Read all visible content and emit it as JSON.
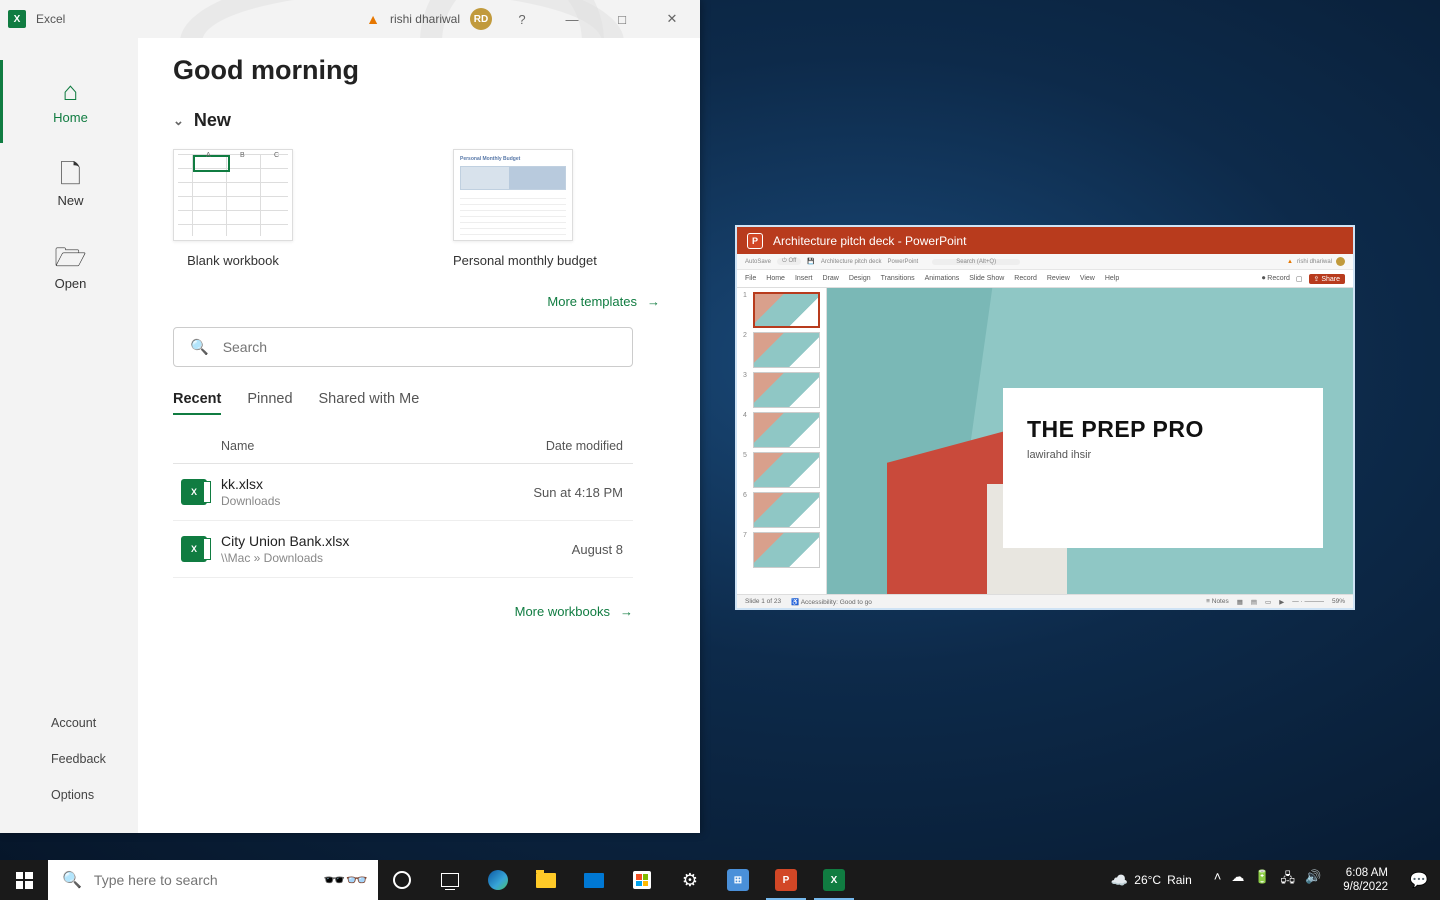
{
  "excel": {
    "app_name": "Excel",
    "user_name": "rishi dhariwal",
    "user_initials": "RD",
    "sidebar": {
      "home": "Home",
      "new": "New",
      "open": "Open",
      "account": "Account",
      "feedback": "Feedback",
      "options": "Options"
    },
    "greeting": "Good morning",
    "new_section": "New",
    "templates": {
      "blank": "Blank workbook",
      "budget": "Personal monthly budget"
    },
    "more_templates": "More templates",
    "search_placeholder": "Search",
    "tabs": {
      "recent": "Recent",
      "pinned": "Pinned",
      "shared": "Shared with Me"
    },
    "columns": {
      "name": "Name",
      "date": "Date modified"
    },
    "files": [
      {
        "name": "kk.xlsx",
        "path": "Downloads",
        "date": "Sun at 4:18 PM"
      },
      {
        "name": "City Union Bank.xlsx",
        "path": "\\\\Mac » Downloads",
        "date": "August 8"
      }
    ],
    "more_workbooks": "More workbooks"
  },
  "ppt": {
    "window_title": "Architecture pitch deck - PowerPoint",
    "autosave": "AutoSave",
    "doc_name": "Architecture pitch deck",
    "app_hint": "PowerPoint",
    "search_hint": "Search (Alt+Q)",
    "user_name": "rishi dhariwal",
    "ribbon": [
      "File",
      "Home",
      "Insert",
      "Draw",
      "Design",
      "Transitions",
      "Animations",
      "Slide Show",
      "Record",
      "Review",
      "View",
      "Help"
    ],
    "record_btn": "Record",
    "share_btn": "Share",
    "slide_title": "THE PREP PRO",
    "slide_sub": "lawirahd ihsir",
    "status_left": "Slide 1 of 23",
    "status_acc": "Accessibility: Good to go",
    "status_notes": "Notes",
    "zoom": "59%"
  },
  "taskbar": {
    "search_placeholder": "Type here to search",
    "weather_temp": "26°C",
    "weather_cond": "Rain",
    "time": "6:08 AM",
    "date": "9/8/2022"
  }
}
